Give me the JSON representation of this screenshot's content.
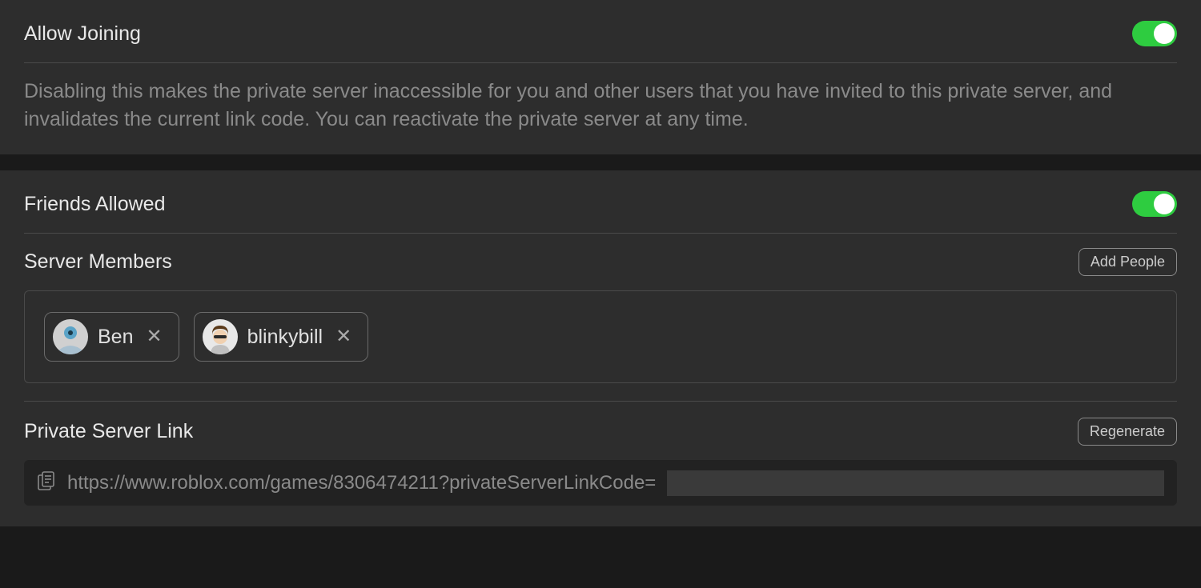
{
  "allow_joining": {
    "title": "Allow Joining",
    "enabled": true,
    "description": "Disabling this makes the private server inaccessible for you and other users that you have invited to this private server, and invalidates the current link code. You can reactivate the private server at any time."
  },
  "friends_allowed": {
    "title": "Friends Allowed",
    "enabled": true
  },
  "server_members": {
    "title": "Server Members",
    "add_button": "Add People",
    "members": [
      {
        "name": "Ben"
      },
      {
        "name": "blinkybill"
      }
    ]
  },
  "private_link": {
    "title": "Private Server Link",
    "regenerate_button": "Regenerate",
    "url_visible": "https://www.roblox.com/games/8306474211?privateServerLinkCode="
  }
}
